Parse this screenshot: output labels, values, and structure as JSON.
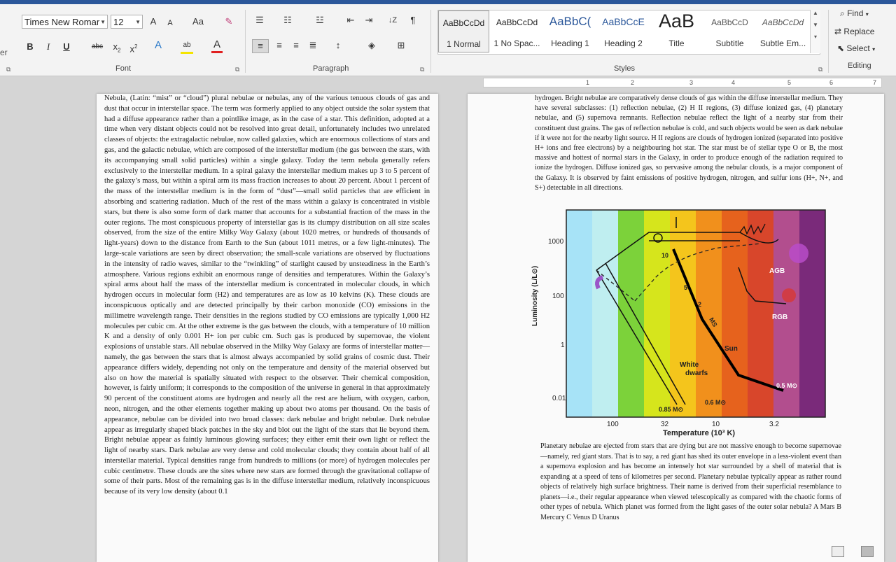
{
  "ribbon": {
    "font": {
      "name": "Times New Romar",
      "size": "12",
      "grow": "A",
      "shrink": "A",
      "change_case": "Aa",
      "bold": "B",
      "italic": "I",
      "underline": "U",
      "strike": "abc",
      "subscript": "x",
      "superscript": "x",
      "text_effects": "A",
      "highlight": "ab",
      "font_color": "A",
      "group_label": "Font"
    },
    "paragraph": {
      "group_label": "Paragraph",
      "show_marks": "¶"
    },
    "styles": {
      "group_label": "Styles",
      "items": [
        {
          "sample": "AaBbCcDd",
          "name": "1 Normal"
        },
        {
          "sample": "AaBbCcDd",
          "name": "1 No Spac..."
        },
        {
          "sample": "AaBbC(",
          "name": "Heading 1"
        },
        {
          "sample": "AaBbCcE",
          "name": "Heading 2"
        },
        {
          "sample": "AaB",
          "name": "Title"
        },
        {
          "sample": "AaBbCcD",
          "name": "Subtitle"
        },
        {
          "sample": "AaBbCcDd",
          "name": "Subtle Em..."
        }
      ]
    },
    "editing": {
      "find": "Find",
      "replace": "Replace",
      "select": "Select",
      "group_label": "Editing"
    }
  },
  "ruler": {
    "labels": [
      "1",
      "2",
      "3",
      "4",
      "5",
      "6",
      "7"
    ]
  },
  "page1": {
    "text": "Nebula, (Latin: “mist” or “cloud”) plural nebulae or nebulas, any of the various tenuous clouds of gas and dust that occur in interstellar space. The term was formerly applied to any object outside the solar system that had a diffuse appearance rather than a pointlike image, as in the case of a star. This definition, adopted at a time when very distant objects could not be resolved into great detail, unfortunately includes two unrelated classes of objects: the extragalactic nebulae, now called galaxies, which are enormous collections of stars and gas, and the galactic nebulae, which are composed of the interstellar medium (the gas between the stars, with its accompanying small solid particles) within a single galaxy. Today the term nebula generally refers exclusively to the interstellar medium. In a spiral galaxy the interstellar medium makes up 3 to 5 percent of the galaxy’s mass, but within a spiral arm its mass fraction increases to about 20 percent. About 1 percent of the mass of the interstellar medium is in the form of “dust”—small solid particles that are efficient in absorbing and scattering radiation. Much of the rest of the mass within a galaxy is concentrated in visible stars, but there is also some form of dark matter that accounts for a substantial fraction of the mass in the outer regions. The most conspicuous property of interstellar gas is its clumpy distribution on all size scales observed, from the size of the entire Milky Way Galaxy (about 1020 metres, or hundreds of thousands of light-years) down to the distance from Earth to the Sun (about 1011 metres, or a few light-minutes). The large-scale variations are seen by direct observation; the small-scale variations are observed by fluctuations in the intensity of radio waves, similar to the “twinkling” of starlight caused by unsteadiness in the Earth’s atmosphere. Various regions exhibit an enormous range of densities and temperatures. Within the Galaxy’s spiral arms about half the mass of the interstellar medium is concentrated in molecular clouds, in which hydrogen occurs in molecular form (H2) and temperatures are as low as 10 kelvins (K). These clouds are inconspicuous optically and are detected principally by their carbon monoxide (CO) emissions in the millimetre wavelength range. Their densities in the regions studied by CO emissions are typically 1,000 H2 molecules per cubic cm. At the other extreme is the gas between the clouds, with a temperature of 10 million K and a density of only 0.001 H+ ion per cubic cm. Such gas is produced by supernovae, the violent explosions of unstable stars. All nebulae observed in the Milky Way Galaxy are forms of interstellar matter—namely, the gas between the stars that is almost always accompanied by solid grains of cosmic dust. Their appearance differs widely, depending not only on the temperature and density of the material observed but also on how the material is spatially situated with respect to the observer. Their chemical composition, however, is fairly uniform; it corresponds to the composition of the universe in general in that approximately 90 percent of the constituent atoms are hydrogen and nearly all the rest are helium, with oxygen, carbon, neon, nitrogen, and the other elements together making up about two atoms per thousand. On the basis of appearance, nebulae can be divided into two broad classes: dark nebulae and bright nebulae. Dark nebulae appear as irregularly shaped black patches in the sky and blot out the light of the stars that lie beyond them. Bright nebulae appear as faintly luminous glowing surfaces; they either emit their own light or reflect the light of nearby stars. Dark nebulae are very dense and cold molecular clouds; they contain about half of all interstellar material. Typical densities range from hundreds to millions (or more) of hydrogen molecules per cubic centimetre. These clouds are the sites where new stars are formed through the gravitational collapse of some of their parts. Most of the remaining gas is in the diffuse interstellar medium, relatively inconspicuous because of its very low density (about 0.1"
  },
  "page2": {
    "text_top": "hydrogen. Bright nebulae are comparatively dense clouds of gas within the diffuse interstellar medium. They have several subclasses: (1) reflection nebulae, (2) H II regions, (3) diffuse ionized gas, (4) planetary nebulae, and (5) supernova remnants. Reflection nebulae reflect the light of a nearby star from their constituent dust grains. The gas of reflection nebulae is cold, and such objects would be seen as dark nebulae if it were not for the nearby light source. H II regions are clouds of hydrogen ionized (separated into positive H+ ions and free electrons) by a neighbouring hot star. The star must be of stellar type O or B, the most massive and hottest of normal stars in the Galaxy, in order to produce enough of the radiation required to ionize the hydrogen. Diffuse ionized gas, so pervasive among the nebular clouds, is a major component of the Galaxy. It is observed by faint emissions of positive hydrogen, nitrogen, and sulfur ions (H+, N+, and S+) detectable in all directions.",
    "text_bottom": "Planetary nebulae are ejected from stars that are dying but are not massive enough to become supernovae—namely, red giant stars. That is to say, a red giant has shed its outer envelope in a less-violent event than a supernova explosion and has become an intensely hot star surrounded by a shell of material that is expanding at a speed of tens of kilometres per second. Planetary nebulae typically appear as rather round objects of relatively high surface brightness. Their name is derived from their superficial resemblance to planets—i.e., their regular appearance when viewed telescopically as compared with the chaotic forms of other types of nebula. Which planet was formed from the light gases of the outer solar nebula? A Mars B Mercury C Venus D Uranus"
  },
  "figure": {
    "y_axis_label": "Luminosity (L/L⊙)",
    "x_axis_label": "Temperature (10³ K)",
    "y_ticks": [
      "1000",
      "100",
      "1",
      "0.01"
    ],
    "x_ticks": [
      "100",
      "32",
      "10",
      "3.2"
    ],
    "labels": {
      "agb": "AGB",
      "rgb": "RGB",
      "ms": "MS",
      "sun": "Sun",
      "white_dwarfs_1": "White",
      "white_dwarfs_2": "dwarfs",
      "m_085": "0.85 M⊙",
      "m_06": "0.6 M⊙",
      "m_05": "0.5 M⊙",
      "n10": "10",
      "n5": "5",
      "n2": "2"
    },
    "band_colors": [
      "#a7e3f7",
      "#bfeef0",
      "#7cd23a",
      "#d6e51c",
      "#f4c51c",
      "#f1901c",
      "#e6621d",
      "#d8462b",
      "#b24e8e",
      "#7a2a7a"
    ]
  }
}
